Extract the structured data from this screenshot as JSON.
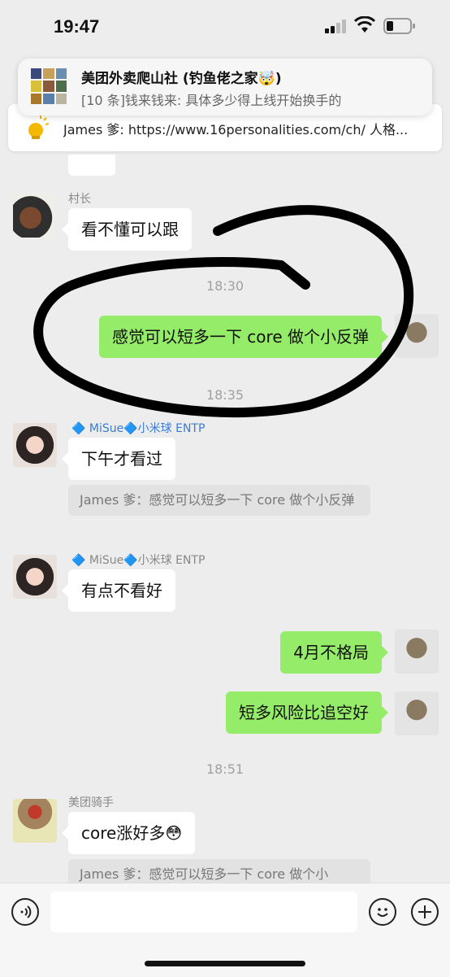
{
  "status": {
    "time": "19:47"
  },
  "notification": {
    "title": "美团外卖爬山社 (钓鱼佬之家🤯)",
    "body": "[10 条]钱来钱来: 具体多少得上线开始换手的"
  },
  "pinned": {
    "text": "James 爹: https://www.16personalities.com/ch/ 人格..."
  },
  "messages": {
    "m1_nick": "村长",
    "m1_text": "看不懂可以跟",
    "ts1": "18:30",
    "m2_text": "感觉可以短多一下 core 做个小反弹",
    "ts2": "18:35",
    "m3_nick": "🔷 MiSue🔷小米球 ENTP",
    "m3_text": "下午才看过",
    "m3_quote": "James 爹：感觉可以短多一下 core 做个小反弹",
    "m4_nick": "🔷 MiSue🔷小米球 ENTP",
    "m4_text": "有点不看好",
    "m5_text": "4月不格局",
    "m6_text": "短多风险比追空好",
    "ts3": "18:51",
    "m7_nick": "美团骑手",
    "m7_text": "core涨好多😳",
    "m7_quote": "James 爹：感觉可以短多一下 core 做个小"
  },
  "colors": {
    "my_bubble": "#95ec69",
    "bg": "#ededed"
  }
}
